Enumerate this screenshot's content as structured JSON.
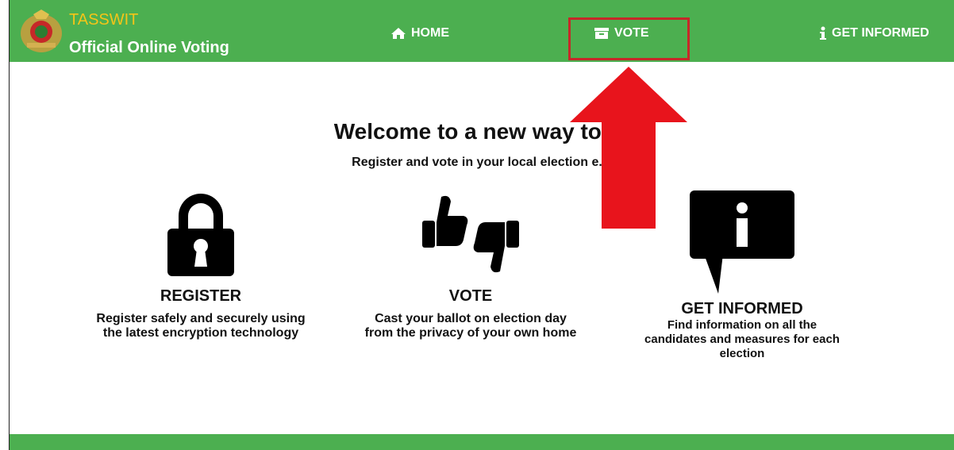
{
  "brand": {
    "name": "TASSWIT",
    "subtitle": "Official Online Voting",
    "emblem_icon": "coat-of-arms-emblem"
  },
  "nav": {
    "home": {
      "label": "HOME",
      "icon": "home-icon"
    },
    "vote": {
      "label": "VOTE",
      "icon": "ballot-box-icon"
    },
    "info": {
      "label": "GET INFORMED",
      "icon": "info-icon"
    }
  },
  "hero": {
    "title": "Welcome to a new way to v",
    "subtitle": "Register and vote in your local election          e."
  },
  "features": [
    {
      "title": "REGISTER",
      "desc_line1": "Register safely and securely using",
      "desc_line2": "the latest encryption technology",
      "icon": "padlock-icon"
    },
    {
      "title": "VOTE",
      "desc_line1": "Cast your ballot on election day",
      "desc_line2": "from the privacy of your own home",
      "icon": "thumbs-up-down-icon"
    },
    {
      "title": "GET INFORMED",
      "desc_line1": "Find information on all the",
      "desc_line2": "candidates and measures for each",
      "desc_line3": "election",
      "icon": "info-speech-bubble-icon"
    }
  ],
  "colors": {
    "nav_bg": "#4caf50",
    "brand_name": "#f5c518",
    "highlight": "#c62828",
    "arrow": "#e8141c"
  }
}
